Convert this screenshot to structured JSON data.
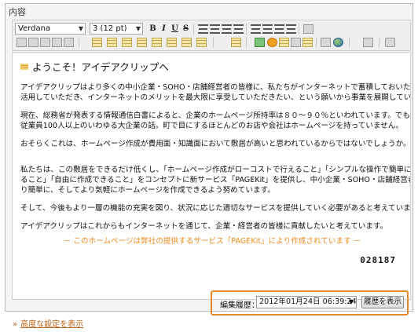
{
  "field": {
    "label": "内容"
  },
  "toolbar": {
    "font_family": "Verdana",
    "font_size": "3 (12 pt)",
    "bold": "B",
    "italic": "I",
    "underline": "U",
    "strike": "S"
  },
  "editor": {
    "heading": "ようこそ！アイデアクリップへ",
    "paragraphs": [
      "アイデアクリップはより多くの中小企業・SOHO・店舗経営者の皆様に、私たちがインターネットで蓄積しておいたアイデアを",
      "活用していただき、インターネットのメリットを最大限に享受していただきたい、という願いから事業を展開しています。",
      "現在、総務省が発表する情報通信白書によると、企業のホームページ所持率は８０〜９０％といわれています。でもこれは",
      "従業員100人以上のいわゆる大企業の話。町で目にするほとんどのお店や会社はホームページを持っていません。",
      "おそらくこれは、ホームページ作成が費用面・知識面において敷居が高いと思われているからではないでしょうか。",
      "私たちは、この敷居をできるだけ低くし、「ホームページ作成がローコストで行えること」「シンプルな操作で簡単に作成でき",
      "ること」「自由に作成できること」をコンセプトに新サービス「PAGEKit」を提供し、中小企業・SOHO・店舗経営者の皆様がよ",
      "り簡単に、そしてより気軽にホームページを作成できるよう努めています。",
      "そして、今後もより一層の機能の充実を図り、状況に応じた適切なサービスを提供していく必要があると考えています。",
      "アイデアクリップはこれからもインターネットを通じて、企業・経営者の皆様に貢献したいと考えています。"
    ],
    "footer_note": "－ このホームページは弊社の提供するサービス「PAGEKit」により作成されています －",
    "code": "028187"
  },
  "history": {
    "label": "編集履歴：",
    "selected": "2012年01月24日 06:39:24",
    "button": "履歴を表示"
  },
  "advanced": {
    "link": "高度な設定を表示"
  },
  "colors": {
    "accent": "#e8862a",
    "link": "#c0631a",
    "note": "#f08a1c"
  }
}
